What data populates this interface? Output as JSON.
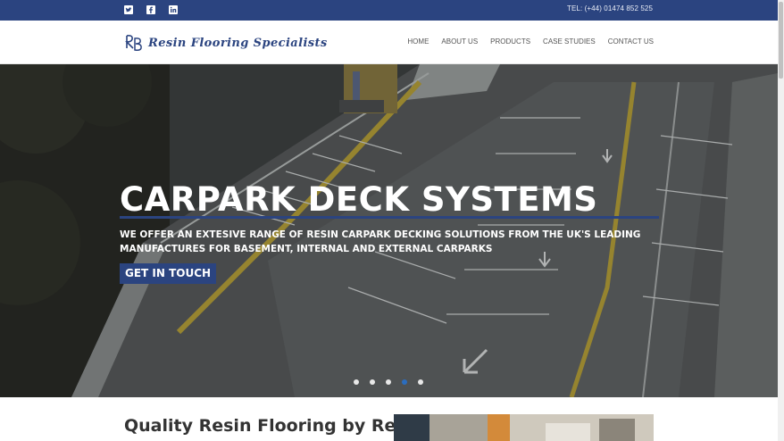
{
  "topbar": {
    "social": [
      {
        "name": "twitter",
        "icon": "twitter-icon"
      },
      {
        "name": "facebook",
        "icon": "facebook-icon"
      },
      {
        "name": "linkedin",
        "icon": "linkedin-icon"
      }
    ],
    "phone": "TEL: (+44) 01474 852 525",
    "color": "#2b4480"
  },
  "header": {
    "logo_text": "Resin Flooring Specialists",
    "logo_icon": "rfs-monogram-icon",
    "nav": [
      "HOME",
      "ABOUT US",
      "PRODUCTS",
      "CASE STUDIES",
      "CONTACT US"
    ]
  },
  "hero": {
    "title": "CARPARK DECK SYSTEMS",
    "subtitle": "WE OFFER AN EXTESIVE RANGE OF RESIN CARPARK DECKING SOLUTIONS FROM THE UK'S LEADING MANUFACTURES FOR BASEMENT, INTERNAL AND EXTERNAL CARPARKS",
    "cta_label": "GET IN TOUCH",
    "slides": 5,
    "active_slide": 4,
    "accent": "#2b4480",
    "dot_active_color": "#2b6dbf"
  },
  "intro": {
    "title": "Quality Resin Flooring by Resin Flooring Specialists Ltd"
  }
}
